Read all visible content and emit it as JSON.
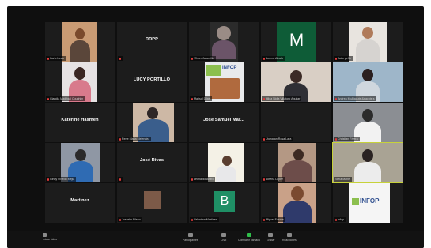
{
  "meeting": {
    "tiles": [
      {
        "label": "Karla Lizza",
        "big_name": ""
      },
      {
        "label": "",
        "big_name": "RRPP"
      },
      {
        "label": "Vilmer Jaramillo",
        "big_name": ""
      },
      {
        "label": "Lorena Alcala",
        "big_name": ""
      },
      {
        "label": "Jairo pefia",
        "big_name": ""
      },
      {
        "label": "Claudia Madrigal Coughlin",
        "big_name": ""
      },
      {
        "label": "",
        "big_name": "LUCY PORTILLO"
      },
      {
        "label": "Marisol Dilas",
        "big_name": ""
      },
      {
        "label": "Hilda Nidia Villatoro Aguilar",
        "big_name": ""
      },
      {
        "label": "Andrea Mo&iacute;&eacute;s",
        "big_name": ""
      },
      {
        "label": "",
        "big_name": "Katerine Hasmen"
      },
      {
        "label": "Rene Maria Melendez",
        "big_name": ""
      },
      {
        "label": "",
        "big_name": "José Samuel Mar..."
      },
      {
        "label": "Jhonatan Rosa Lara",
        "big_name": ""
      },
      {
        "label": "Christian Rivera",
        "big_name": ""
      },
      {
        "label": "Cindy Oviedo Mejia",
        "big_name": ""
      },
      {
        "label": "",
        "big_name": "José Rivas"
      },
      {
        "label": "Leonardo Alfaro",
        "big_name": ""
      },
      {
        "label": "Lorena Lopez",
        "big_name": ""
      },
      {
        "label": "Stela Mariel",
        "big_name": ""
      },
      {
        "label": "",
        "big_name": "Martinez"
      },
      {
        "label": "Joscelin Fileno",
        "big_name": ""
      },
      {
        "label": "Valentina Martinez",
        "big_name": ""
      },
      {
        "label": "Miguel Fuente",
        "big_name": ""
      },
      {
        "label": "Infop",
        "big_name": ""
      }
    ],
    "avatar_letters": {
      "m": "M",
      "b": "B"
    },
    "logos": {
      "infop_top": "INFOP",
      "infop_bottom": "INFOP"
    },
    "toolbar": {
      "mute": "Iniciar video",
      "participants": "Participantes",
      "chat": "Chat",
      "share": "Compartir pantalla",
      "record": "Grabar",
      "reactions": "Reacciones"
    },
    "colors": {
      "tile_bg": "#1c1c1c",
      "active_border": "#c7d23a",
      "m_avatar": "#0e5c37",
      "b_avatar": "#1f8f65",
      "share_green": "#2fbf4a"
    }
  }
}
